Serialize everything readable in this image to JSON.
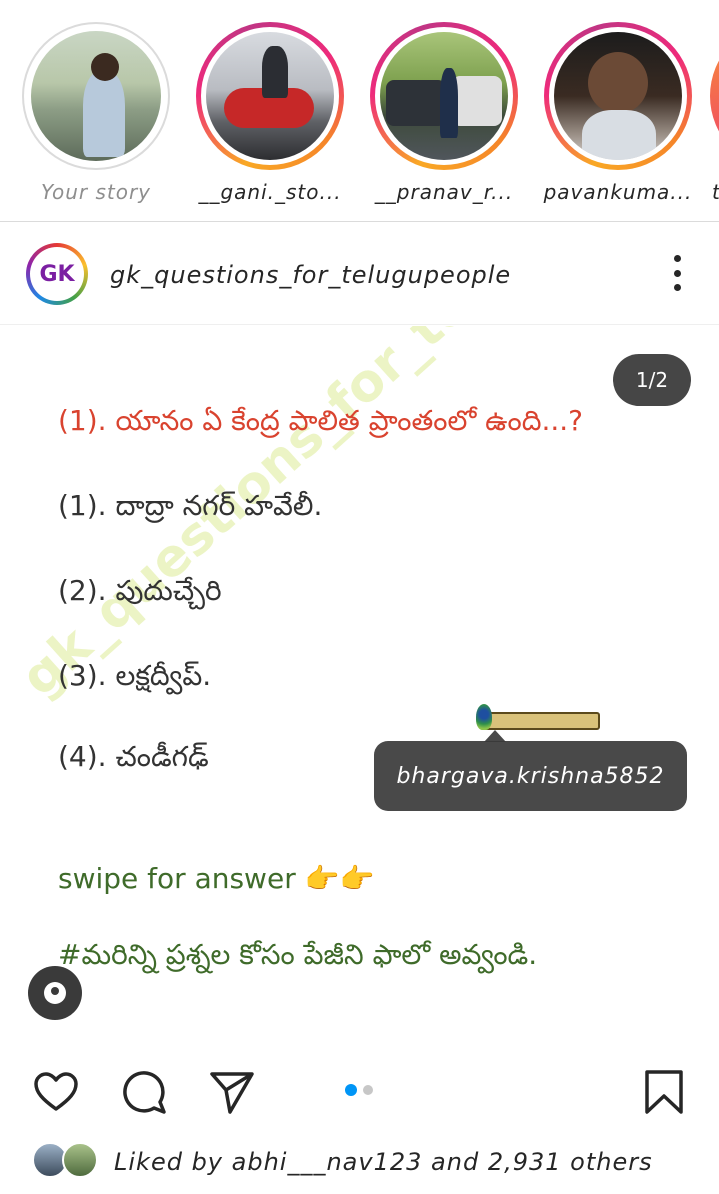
{
  "stories": [
    {
      "label": "Your story",
      "own": true
    },
    {
      "label": "__gani._sto...",
      "own": false
    },
    {
      "label": "__pranav_r...",
      "own": false
    },
    {
      "label": "pavankuma...",
      "own": false
    },
    {
      "label": "t",
      "own": false
    }
  ],
  "post": {
    "avatar_text": "GK",
    "username": "gk_questions_for_telugupeople",
    "counter": "1/2",
    "watermark": "gk_questions_for_telugu_people",
    "question": "(1). యానం ఏ కేంద్ర పాలిత ప్రాంతంలో ఉంది...?",
    "options": [
      "(1). దాద్రా నగర్ హవేలీ.",
      "(2). పుదుచ్చేరి",
      "(3). లక్షద్వీప్.",
      "(4). చండీగఢ్"
    ],
    "swipe": "swipe for answer 👉👉",
    "hashtag": "#మరిన్ని ప్రశ్నల కోసం పేజీని ఫాలో అవ్వండి.",
    "tagged_user": "bhargava.krishna5852",
    "carousel_total": 2,
    "carousel_index": 1
  },
  "likes": {
    "prefix": "Liked by ",
    "user": "abhi___nav123",
    "middle": " and ",
    "count": "2,931 others"
  },
  "colors": {
    "accent_blue": "#0095f6",
    "question_red": "#d9432f",
    "green_text": "#3f6b2a"
  },
  "icons": [
    "heart-icon",
    "comment-icon",
    "share-icon",
    "bookmark-icon",
    "more-icon",
    "person-tag-icon"
  ]
}
